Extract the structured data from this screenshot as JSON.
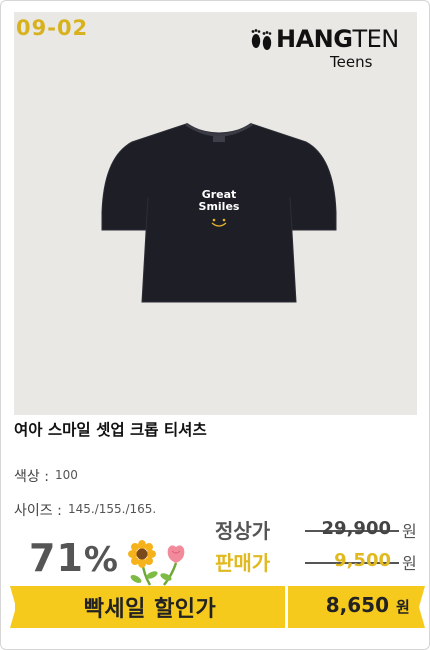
{
  "product_card": {
    "image": {
      "code_badge": "09-02",
      "brand": {
        "name_bold": "HANG",
        "name_light": "TEN",
        "sub": "Teens"
      },
      "shirt_print": {
        "line1": "Great",
        "line2": "Smiles"
      },
      "background_color": "#e9e8e4",
      "shirt_color": "#1e1f26"
    },
    "title": "여아 스마일 셋업 크롭 티셔츠",
    "color": {
      "label": "색상 :",
      "value": "100"
    },
    "size": {
      "label": "사이즈 :",
      "value": "145./155./165."
    },
    "discount": {
      "percent": "71",
      "sign": "%"
    },
    "prices": {
      "regular_label": "정상가",
      "regular_price": "29,900",
      "sale_label": "판매가",
      "sale_price": "9,500",
      "unit": "원"
    },
    "promo_bar": {
      "label": "빡세일 할인가",
      "price": "8,650",
      "unit": "원",
      "color": "#f6c91d"
    },
    "accent_color": "#e1b920"
  }
}
